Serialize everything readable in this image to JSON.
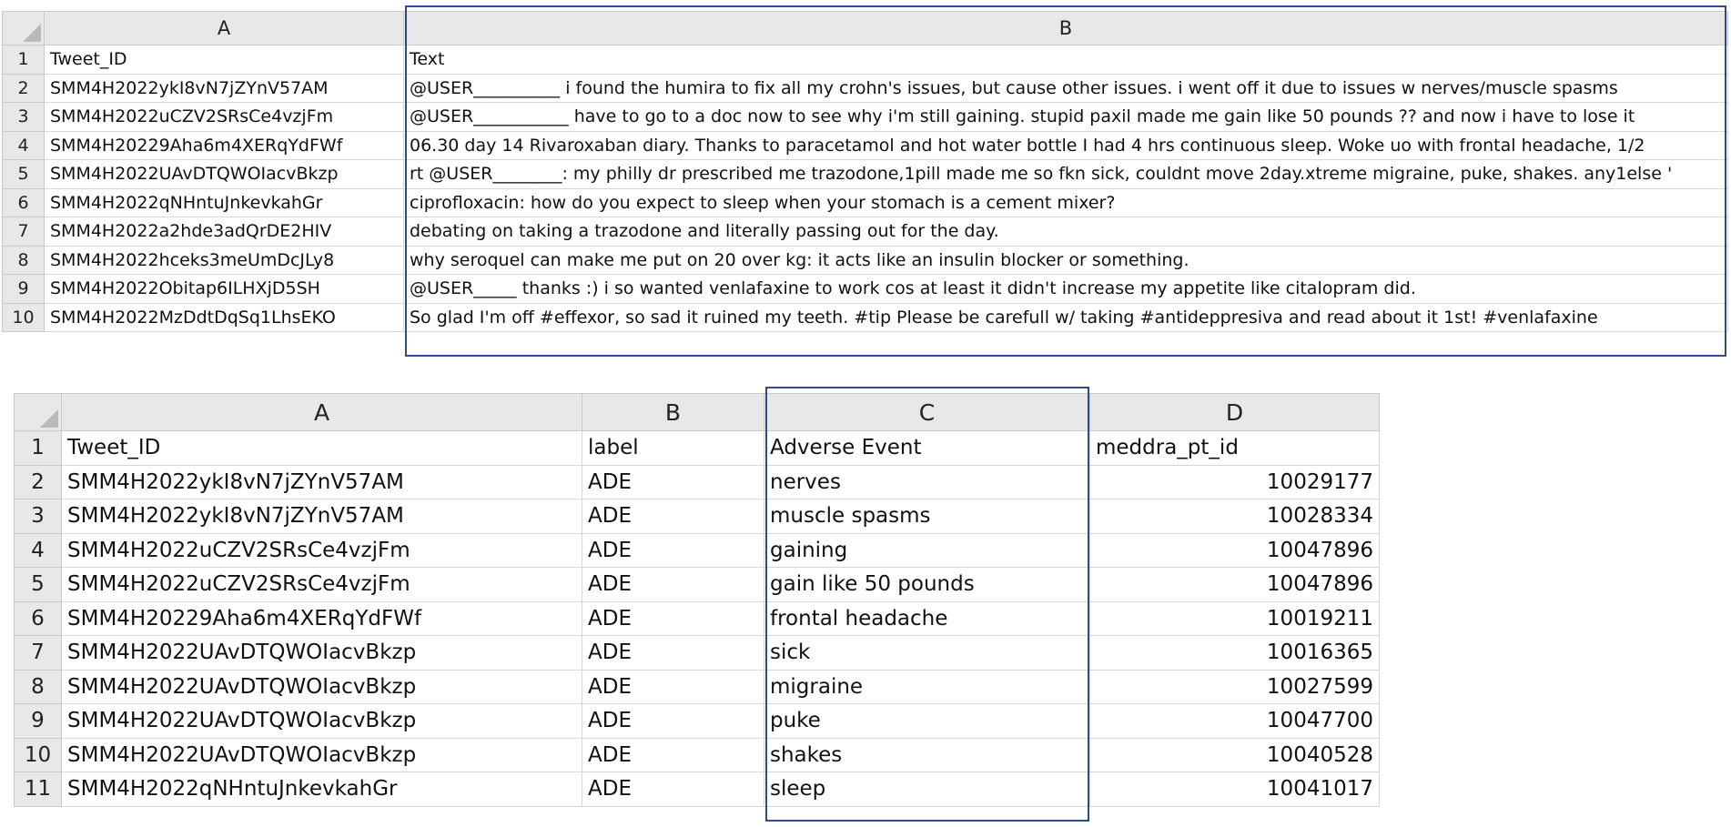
{
  "sheet1": {
    "columns": [
      "A",
      "B"
    ],
    "rows": [
      {
        "n": "1",
        "a": "Tweet_ID",
        "b": "Text"
      },
      {
        "n": "2",
        "a": "SMM4H2022ykI8vN7jZYnV57AM",
        "b": "@USER__________ i found the humira to fix all my crohn's issues, but cause other issues. i went off it due to issues w nerves/muscle spasms"
      },
      {
        "n": "3",
        "a": "SMM4H2022uCZV2SRsCe4vzjFm",
        "b": "@USER___________ have to go to a doc now to see why i'm still gaining. stupid paxil made me gain like 50 pounds ?? and now i have to lose it"
      },
      {
        "n": "4",
        "a": "SMM4H20229Aha6m4XERqYdFWf",
        "b": "06.30 day 14 Rivaroxaban diary. Thanks to paracetamol and hot water bottle I had 4 hrs continuous sleep. Woke uo with frontal headache, 1/2"
      },
      {
        "n": "5",
        "a": "SMM4H2022UAvDTQWOIacvBkzp",
        "b": "rt @USER________: my philly dr prescribed me trazodone,1pill made me so fkn sick, couldnt move 2day.xtreme migraine, puke, shakes. any1else '"
      },
      {
        "n": "6",
        "a": "SMM4H2022qNHntuJnkevkahGr",
        "b": "ciprofloxacin: how do you expect to sleep when your stomach is a cement mixer?"
      },
      {
        "n": "7",
        "a": "SMM4H2022a2hde3adQrDE2HIV",
        "b": "debating on taking a trazodone and literally passing out for the day."
      },
      {
        "n": "8",
        "a": "SMM4H2022hceks3meUmDcJLy8",
        "b": "why seroquel can make me put on 20 over kg: it acts like an insulin blocker or something."
      },
      {
        "n": "9",
        "a": "SMM4H2022Obitap6ILHXjD5SH",
        "b": "@USER_____ thanks :) i so wanted venlafaxine to work cos at least it didn't increase my appetite like citalopram did."
      },
      {
        "n": "10",
        "a": "SMM4H2022MzDdtDqSq1LhsEKO",
        "b": "So glad I'm off #effexor, so sad it ruined my teeth. #tip Please be carefull w/ taking #antideppresiva and read about it 1st! #venlafaxine"
      }
    ]
  },
  "sheet2": {
    "columns": [
      "A",
      "B",
      "C",
      "D"
    ],
    "rows": [
      {
        "n": "1",
        "a": "Tweet_ID",
        "b": "label",
        "c": "Adverse Event",
        "d": "meddra_pt_id"
      },
      {
        "n": "2",
        "a": "SMM4H2022ykI8vN7jZYnV57AM",
        "b": "ADE",
        "c": "nerves",
        "d": "10029177"
      },
      {
        "n": "3",
        "a": "SMM4H2022ykI8vN7jZYnV57AM",
        "b": "ADE",
        "c": "muscle spasms",
        "d": "10028334"
      },
      {
        "n": "4",
        "a": "SMM4H2022uCZV2SRsCe4vzjFm",
        "b": "ADE",
        "c": "gaining",
        "d": "10047896"
      },
      {
        "n": "5",
        "a": "SMM4H2022uCZV2SRsCe4vzjFm",
        "b": "ADE",
        "c": "gain like 50 pounds",
        "d": "10047896"
      },
      {
        "n": "6",
        "a": "SMM4H20229Aha6m4XERqYdFWf",
        "b": "ADE",
        "c": "frontal headache",
        "d": "10019211"
      },
      {
        "n": "7",
        "a": "SMM4H2022UAvDTQWOIacvBkzp",
        "b": "ADE",
        "c": "sick",
        "d": "10016365"
      },
      {
        "n": "8",
        "a": "SMM4H2022UAvDTQWOIacvBkzp",
        "b": "ADE",
        "c": "migraine",
        "d": "10027599"
      },
      {
        "n": "9",
        "a": "SMM4H2022UAvDTQWOIacvBkzp",
        "b": "ADE",
        "c": "puke",
        "d": "10047700"
      },
      {
        "n": "10",
        "a": "SMM4H2022UAvDTQWOIacvBkzp",
        "b": "ADE",
        "c": "shakes",
        "d": "10040528"
      },
      {
        "n": "11",
        "a": "SMM4H2022qNHntuJnkevkahGr",
        "b": "ADE",
        "c": "sleep",
        "d": "10041017"
      }
    ]
  },
  "colors": {
    "header_bg": "#e8e8e8",
    "grid_line": "#d6d6d6",
    "selection_border": "#2f4b8a"
  }
}
